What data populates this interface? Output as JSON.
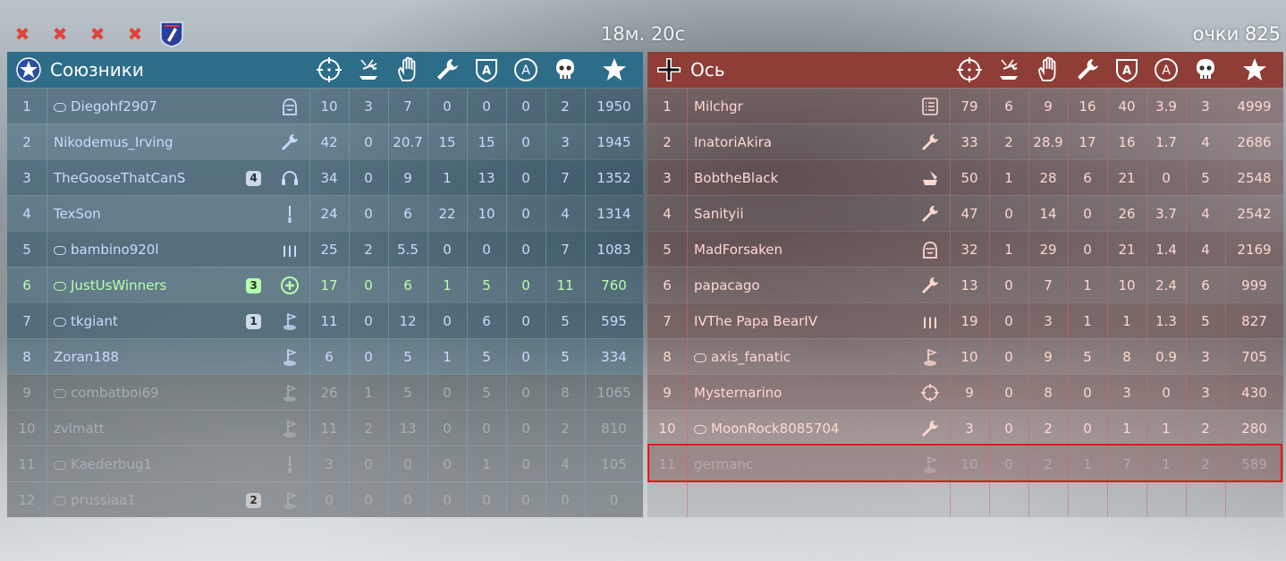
{
  "top": {
    "timer": "18м. 20с",
    "score": "очки 825"
  },
  "allies": {
    "team_name": "Союзники",
    "players": [
      {
        "rank": "1",
        "name": "Diegohf2907",
        "gamepad": true,
        "squad": "",
        "class": "tanker-icon",
        "kills": "10",
        "vehicles": "3",
        "assists": "7",
        "repair": "0",
        "captures": "0",
        "defends": "0",
        "deaths": "2",
        "score": "1950"
      },
      {
        "rank": "2",
        "name": "Nikodemus_Irving",
        "gamepad": false,
        "squad": "",
        "class": "wrench-icon",
        "kills": "42",
        "vehicles": "0",
        "assists": "20.7",
        "repair": "15",
        "captures": "15",
        "defends": "0",
        "deaths": "3",
        "score": "1945"
      },
      {
        "rank": "3",
        "name": "TheGooseThatCanS",
        "gamepad": false,
        "squad": "4",
        "class": "headset-icon",
        "kills": "34",
        "vehicles": "0",
        "assists": "9",
        "repair": "1",
        "captures": "13",
        "defends": "0",
        "deaths": "7",
        "score": "1352"
      },
      {
        "rank": "4",
        "name": "TexSon",
        "gamepad": false,
        "squad": "",
        "class": "knife-icon",
        "kills": "24",
        "vehicles": "0",
        "assists": "6",
        "repair": "22",
        "captures": "10",
        "defends": "0",
        "deaths": "4",
        "score": "1314"
      },
      {
        "rank": "5",
        "name": "bambino920l",
        "gamepad": true,
        "squad": "",
        "class": "ammo-icon",
        "kills": "25",
        "vehicles": "2",
        "assists": "5.5",
        "repair": "0",
        "captures": "0",
        "defends": "0",
        "deaths": "7",
        "score": "1083"
      },
      {
        "rank": "6",
        "name": "JustUsWinners",
        "gamepad": true,
        "squad": "3",
        "class": "medic-icon",
        "kills": "17",
        "vehicles": "0",
        "assists": "6",
        "repair": "1",
        "captures": "5",
        "defends": "0",
        "deaths": "11",
        "score": "760"
      },
      {
        "rank": "7",
        "name": "tkgiant",
        "gamepad": true,
        "squad": "1",
        "class": "flag-icon",
        "kills": "11",
        "vehicles": "0",
        "assists": "12",
        "repair": "0",
        "captures": "6",
        "defends": "0",
        "deaths": "5",
        "score": "595"
      },
      {
        "rank": "8",
        "name": "Zoran188",
        "gamepad": false,
        "squad": "",
        "class": "flag-icon",
        "kills": "6",
        "vehicles": "0",
        "assists": "5",
        "repair": "1",
        "captures": "5",
        "defends": "0",
        "deaths": "5",
        "score": "334"
      },
      {
        "rank": "9",
        "name": "combatboi69",
        "gamepad": true,
        "squad": "",
        "class": "flag-icon",
        "kills": "26",
        "vehicles": "1",
        "assists": "5",
        "repair": "0",
        "captures": "5",
        "defends": "0",
        "deaths": "8",
        "score": "1065"
      },
      {
        "rank": "10",
        "name": "zvlmatt",
        "gamepad": false,
        "squad": "",
        "class": "flag-icon",
        "kills": "11",
        "vehicles": "2",
        "assists": "13",
        "repair": "0",
        "captures": "0",
        "defends": "0",
        "deaths": "2",
        "score": "810"
      },
      {
        "rank": "11",
        "name": "Kaederbug1",
        "gamepad": true,
        "squad": "",
        "class": "knife-icon",
        "kills": "3",
        "vehicles": "0",
        "assists": "0",
        "repair": "0",
        "captures": "1",
        "defends": "0",
        "deaths": "4",
        "score": "105"
      },
      {
        "rank": "12",
        "name": "prussiaa1",
        "gamepad": true,
        "squad": "2",
        "class": "flag-icon",
        "kills": "0",
        "vehicles": "0",
        "assists": "0",
        "repair": "0",
        "captures": "0",
        "defends": "0",
        "deaths": "0",
        "score": "0"
      }
    ]
  },
  "axis": {
    "team_name": "Ось",
    "players": [
      {
        "rank": "1",
        "name": "Milchgr",
        "gamepad": false,
        "class": "list-icon",
        "kills": "79",
        "vehicles": "6",
        "assists": "9",
        "repair": "16",
        "captures": "40",
        "defends": "3.9",
        "deaths": "3",
        "score": "4999"
      },
      {
        "rank": "2",
        "name": "InatoriAkira",
        "gamepad": false,
        "class": "wrench-icon",
        "kills": "33",
        "vehicles": "2",
        "assists": "28.9",
        "repair": "17",
        "captures": "16",
        "defends": "1.7",
        "deaths": "4",
        "score": "2686"
      },
      {
        "rank": "3",
        "name": "BobtheBlack",
        "gamepad": false,
        "class": "artillery-icon",
        "kills": "50",
        "vehicles": "1",
        "assists": "28",
        "repair": "6",
        "captures": "21",
        "defends": "0",
        "deaths": "5",
        "score": "2548"
      },
      {
        "rank": "4",
        "name": "Sanityii",
        "gamepad": false,
        "class": "wrench-icon",
        "kills": "47",
        "vehicles": "0",
        "assists": "14",
        "repair": "0",
        "captures": "26",
        "defends": "3.7",
        "deaths": "4",
        "score": "2542"
      },
      {
        "rank": "5",
        "name": "MadForsaken",
        "gamepad": false,
        "class": "tanker-icon",
        "kills": "32",
        "vehicles": "1",
        "assists": "29",
        "repair": "0",
        "captures": "21",
        "defends": "1.4",
        "deaths": "4",
        "score": "2169"
      },
      {
        "rank": "6",
        "name": "papacago",
        "gamepad": false,
        "class": "wrench-icon",
        "kills": "13",
        "vehicles": "0",
        "assists": "7",
        "repair": "1",
        "captures": "10",
        "defends": "2.4",
        "deaths": "6",
        "score": "999"
      },
      {
        "rank": "7",
        "name": "IVThe Papa BearIV",
        "gamepad": false,
        "class": "ammo-icon",
        "kills": "19",
        "vehicles": "0",
        "assists": "3",
        "repair": "1",
        "captures": "1",
        "defends": "1.3",
        "deaths": "5",
        "score": "827"
      },
      {
        "rank": "8",
        "name": "axis_fanatic",
        "gamepad": true,
        "class": "flag-icon",
        "kills": "10",
        "vehicles": "0",
        "assists": "9",
        "repair": "5",
        "captures": "8",
        "defends": "0.9",
        "deaths": "3",
        "score": "705"
      },
      {
        "rank": "9",
        "name": "Mysternarino",
        "gamepad": false,
        "class": "crosshair-icon",
        "kills": "9",
        "vehicles": "0",
        "assists": "8",
        "repair": "0",
        "captures": "3",
        "defends": "0",
        "deaths": "3",
        "score": "430"
      },
      {
        "rank": "10",
        "name": "MoonRock8085704",
        "gamepad": true,
        "class": "wrench-icon",
        "kills": "3",
        "vehicles": "0",
        "assists": "2",
        "repair": "0",
        "captures": "1",
        "defends": "1",
        "deaths": "2",
        "score": "280"
      },
      {
        "rank": "11",
        "name": "germanc",
        "gamepad": false,
        "class": "flag-icon",
        "kills": "10",
        "vehicles": "0",
        "assists": "2",
        "repair": "1",
        "captures": "7",
        "defends": "1",
        "deaths": "2",
        "score": "589"
      }
    ]
  },
  "colors": {
    "allies_header": "#2d6d88",
    "axis_header": "#8f3d37",
    "highlight": "#e0161a",
    "squad_green": "#b6ffb0",
    "xmark": "#e2443a"
  }
}
